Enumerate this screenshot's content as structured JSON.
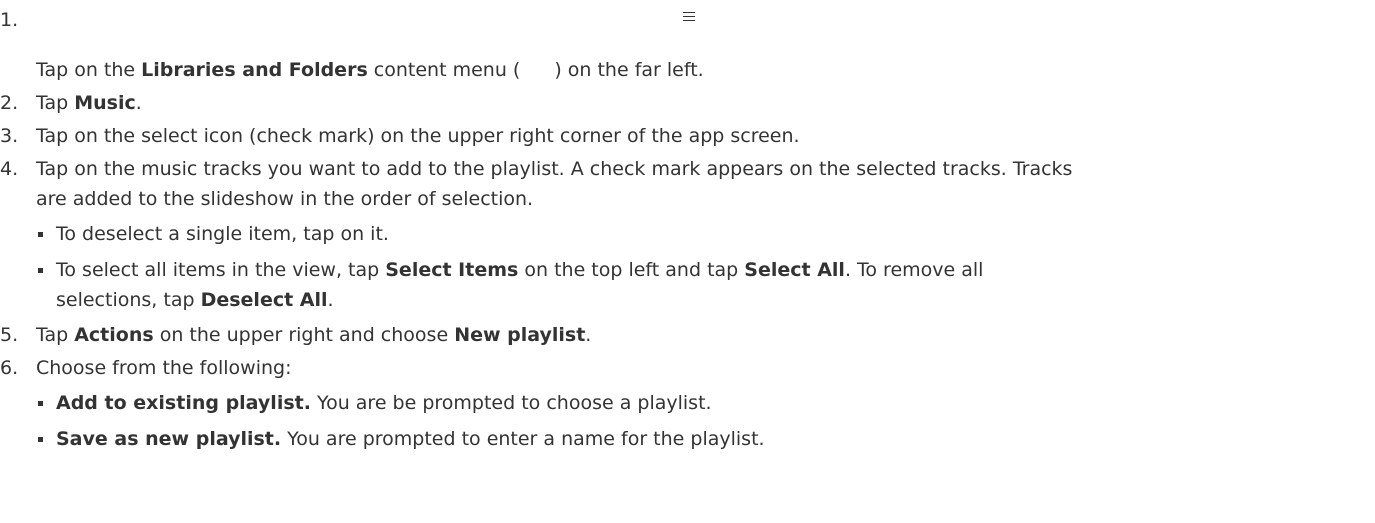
{
  "steps": [
    {
      "num": "1.",
      "pre": "Tap on the ",
      "bold": "Libraries and Folders",
      "post": " content menu (",
      "post2": ") on the far left.",
      "icon": "menu-icon"
    },
    {
      "num": "2.",
      "pre": "Tap ",
      "bold": "Music",
      "post": "."
    },
    {
      "num": "3.",
      "text": "Tap on the select icon (check mark) on the upper right corner of the app screen."
    },
    {
      "num": "4.",
      "line1": "Tap on the music tracks you want to add to the playlist. A check mark appears on the selected tracks. Tracks",
      "line2": "are added to the slideshow in the order of selection.",
      "bullets": [
        {
          "text": "To deselect a single item, tap on it."
        },
        {
          "pre": "To select all items in the view, tap ",
          "bold1": "Select Items",
          "mid": " on the top left and tap ",
          "bold2": "Select All",
          "post": ". To remove all",
          "line2_pre": "selections, tap ",
          "line2_bold": "Deselect All",
          "line2_post": "."
        }
      ]
    },
    {
      "num": "5.",
      "pre": "Tap ",
      "bold1": "Actions",
      "mid": " on the upper right and choose ",
      "bold2": "New playlist",
      "post": "."
    },
    {
      "num": "6.",
      "text": "Choose from the following:",
      "bullets": [
        {
          "bold": "Add to existing playlist.",
          "post": " You are be prompted to choose a playlist."
        },
        {
          "bold": "Save as new playlist.",
          "post": " You are prompted to enter a name for the playlist."
        }
      ]
    }
  ]
}
